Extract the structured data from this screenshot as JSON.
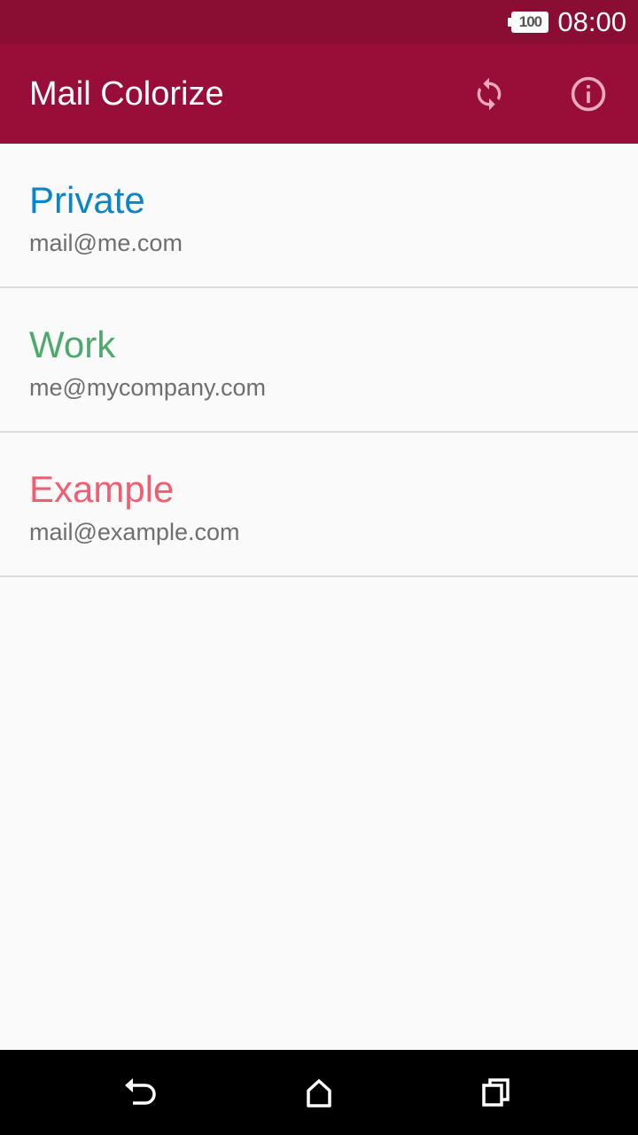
{
  "status_bar": {
    "battery_level": "100",
    "time": "08:00"
  },
  "app_bar": {
    "title": "Mail Colorize",
    "actions": [
      {
        "name": "sync",
        "icon": "sync-icon"
      },
      {
        "name": "info",
        "icon": "info-icon"
      }
    ]
  },
  "accounts": [
    {
      "title": "Private",
      "email": "mail@me.com",
      "color": "#0a86c6"
    },
    {
      "title": "Work",
      "email": "me@mycompany.com",
      "color": "#4ea96c"
    },
    {
      "title": "Example",
      "email": "mail@example.com",
      "color": "#ef5f72"
    }
  ],
  "nav_bar": {
    "buttons": [
      {
        "name": "back",
        "icon": "back-icon"
      },
      {
        "name": "home",
        "icon": "home-icon"
      },
      {
        "name": "recents",
        "icon": "recents-icon"
      }
    ]
  },
  "colors": {
    "status_bar": "#8a0d33",
    "app_bar": "#990e39",
    "background": "#fafafa",
    "divider": "#dcdcdc",
    "secondary_text": "#6f6f6f"
  }
}
